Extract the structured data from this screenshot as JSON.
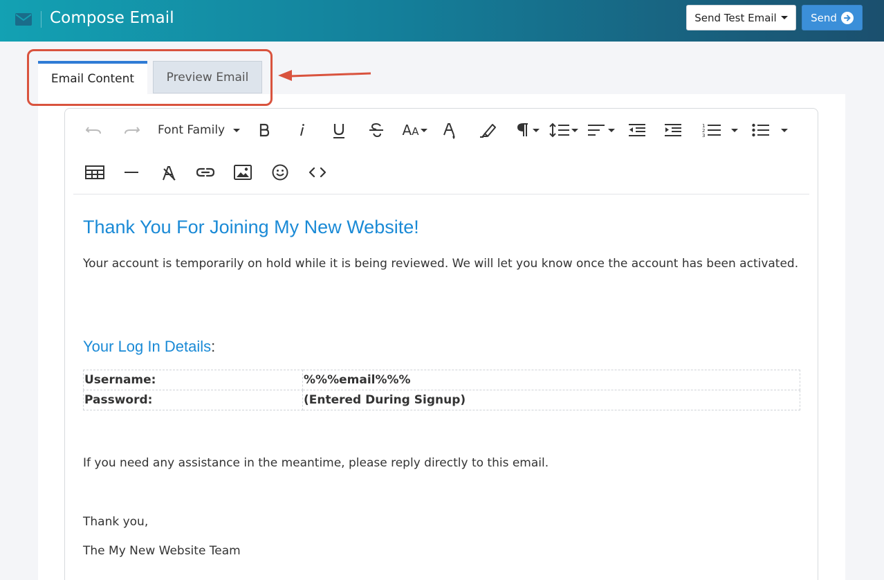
{
  "header": {
    "title": "Compose Email",
    "send_test_label": "Send Test Email",
    "send_label": "Send"
  },
  "tabs": {
    "email_content": "Email Content",
    "preview_email": "Preview Email",
    "active": "Email Content"
  },
  "toolbar": {
    "font_family_label": "Font Family",
    "row1": [
      "undo-icon",
      "redo-icon",
      "font-family",
      "bold-icon",
      "italic-icon",
      "underline-icon",
      "strikethrough-icon",
      "font-size-icon",
      "text-color-icon",
      "highlight-icon",
      "paragraph-icon",
      "line-height-icon",
      "align-icon",
      "outdent-icon",
      "indent-icon",
      "ordered-list-icon",
      "unordered-list-icon"
    ],
    "row2": [
      "table-icon",
      "horizontal-rule-icon",
      "clear-format-icon",
      "link-icon",
      "image-icon",
      "emoji-icon",
      "code-view-icon"
    ]
  },
  "email": {
    "heading": "Thank You For Joining My New Website!",
    "intro": "Your account is temporarily on hold while it is being reviewed.  We will let you know once the account has been activated.",
    "details_heading": "Your Log In Details",
    "details_colon": ":",
    "details": [
      {
        "label": "Username:",
        "value": "%%%email%%%"
      },
      {
        "label": "Password:",
        "value": "(Entered During Signup)"
      }
    ],
    "assistance": "If you need any assistance in the meantime, please reply directly to this email.",
    "closing": "Thank you,",
    "signature": "The My New Website Team"
  },
  "colors": {
    "header_start": "#13a1b3",
    "header_end": "#1b4f6e",
    "accent_blue": "#2f7bd5",
    "heading_blue": "#1a8ad6",
    "annotation_red": "#d9533e"
  }
}
